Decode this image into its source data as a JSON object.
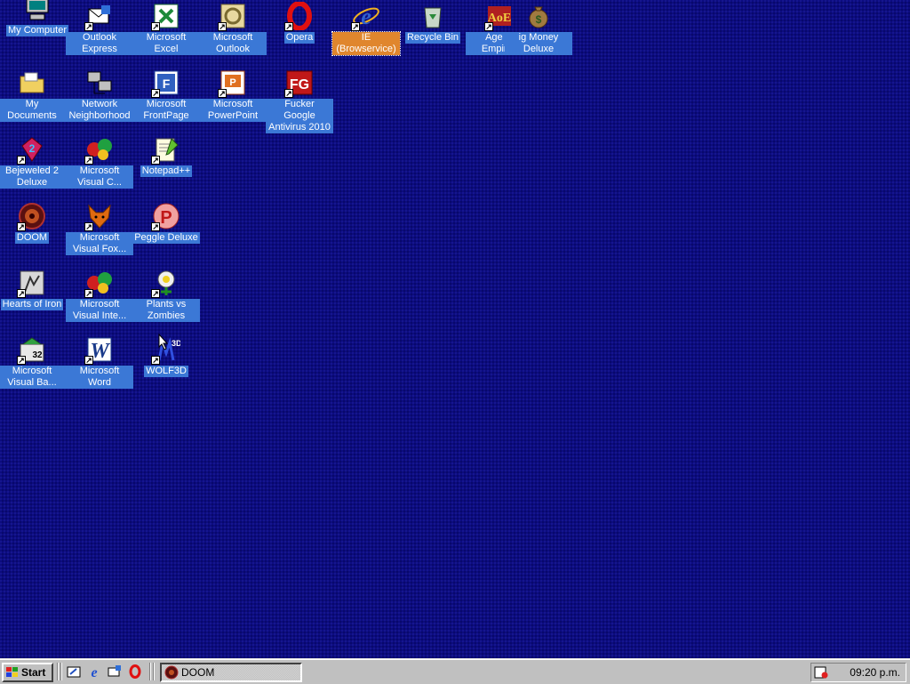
{
  "desktop": {
    "icons": [
      {
        "label": "My Computer",
        "icon": "computer-icon"
      },
      {
        "label": "Outlook Express",
        "icon": "outlook-express-icon"
      },
      {
        "label": "Microsoft Excel",
        "icon": "excel-icon"
      },
      {
        "label": "Microsoft Outlook",
        "icon": "outlook-icon"
      },
      {
        "label": "Opera",
        "icon": "opera-icon"
      },
      {
        "label": "IE (Browservice)",
        "icon": "internet-explorer-icon"
      },
      {
        "label": "Recycle Bin",
        "icon": "recycle-bin-icon"
      },
      {
        "label": "Age of Empires",
        "icon": "age-of-empires-icon"
      },
      {
        "label": "ig Money Deluxe",
        "icon": "money-bag-icon"
      },
      {
        "label": "My Documents",
        "icon": "folder-icon"
      },
      {
        "label": "Network Neighborhood",
        "icon": "network-icon"
      },
      {
        "label": "Microsoft FrontPage",
        "icon": "frontpage-icon"
      },
      {
        "label": "Microsoft PowerPoint",
        "icon": "powerpoint-icon"
      },
      {
        "label": "Fucker Google Antivirus 2010",
        "icon": "antivirus-icon"
      },
      {
        "label": "Bejeweled 2 Deluxe",
        "icon": "bejeweled-icon"
      },
      {
        "label": "Microsoft Visual C...",
        "icon": "visual-studio-icon"
      },
      {
        "label": "Notepad++",
        "icon": "notepad-icon"
      },
      {
        "label": "DOOM",
        "icon": "doom-icon"
      },
      {
        "label": "Microsoft Visual Fox...",
        "icon": "foxpro-icon"
      },
      {
        "label": "Peggle Deluxe",
        "icon": "peggle-icon"
      },
      {
        "label": "Hearts of Iron",
        "icon": "hearts-of-iron-icon"
      },
      {
        "label": "Microsoft Visual Inte...",
        "icon": "visual-interdev-icon"
      },
      {
        "label": "Plants vs Zombies",
        "icon": "plants-vs-zombies-icon"
      },
      {
        "label": "Microsoft Visual Ba...",
        "icon": "visual-basic-icon"
      },
      {
        "label": "Microsoft Word",
        "icon": "word-icon"
      },
      {
        "label": "WOLF3D",
        "icon": "wolf3d-icon"
      }
    ],
    "focused_icon": "IE (Browservice)",
    "background_color": "#0c0c7f",
    "selection_color": "#3b78d6",
    "focus_color": "#e0862d"
  },
  "taskbar": {
    "start_label": "Start",
    "quick_launch": [
      "ie-desktop-icon",
      "internet-explorer-icon",
      "outlook-express-icon",
      "opera-icon"
    ],
    "tasks": [
      {
        "label": "DOOM",
        "icon": "doom-icon"
      }
    ],
    "clock": "09:20 p.m."
  }
}
